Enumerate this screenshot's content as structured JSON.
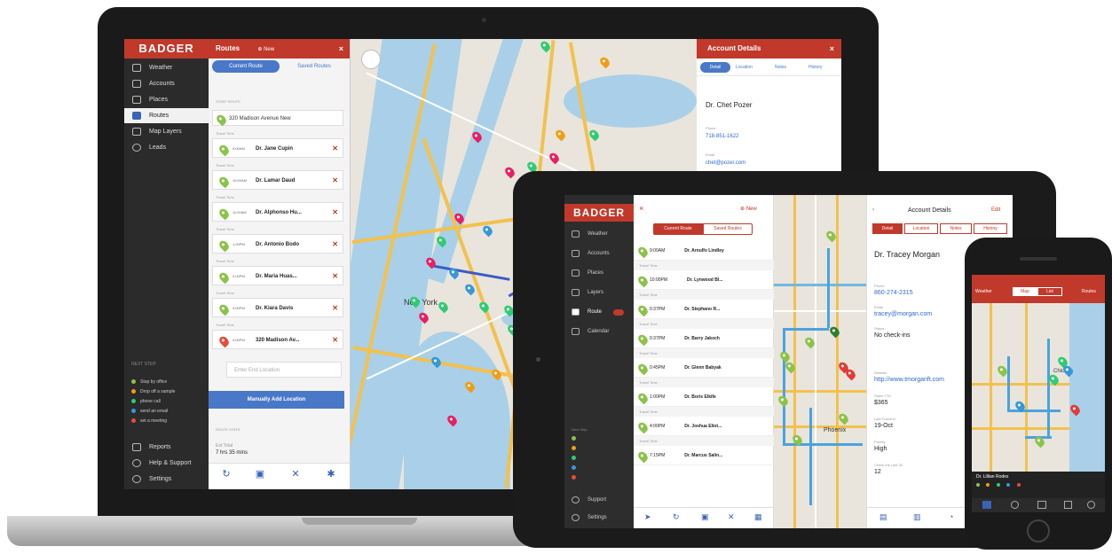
{
  "laptop": {
    "logo": "BADGER",
    "nav": [
      {
        "label": "Weather",
        "icon": "eye-icon"
      },
      {
        "label": "Accounts",
        "icon": "user-icon"
      },
      {
        "label": "Places",
        "icon": "building-icon"
      },
      {
        "label": "Routes",
        "icon": "map-icon",
        "active": true
      },
      {
        "label": "Map Layers",
        "icon": "layers-icon"
      },
      {
        "label": "Leads",
        "icon": "chat-icon"
      }
    ],
    "legend_title": "NEXT STEP",
    "legend": [
      {
        "label": "Stop by office",
        "color": "#8bc34a"
      },
      {
        "label": "Drop off a sample",
        "color": "#f39c12"
      },
      {
        "label": "phone call",
        "color": "#2ecc71"
      },
      {
        "label": "send an email",
        "color": "#3498db"
      },
      {
        "label": "set a meeting",
        "color": "#e74c3c"
      }
    ],
    "bottom_nav": [
      {
        "label": "Reports",
        "icon": "reports-icon"
      },
      {
        "label": "Help & Support",
        "icon": "help-icon"
      },
      {
        "label": "Settings",
        "icon": "gear-icon"
      }
    ],
    "routes_title": "Routes",
    "routes_new": "New",
    "tabs": {
      "current": "Current Route",
      "saved": "Saved Routes"
    },
    "start_label": "START ROUTE",
    "start_address": "320 Madison Avenue New",
    "stops": [
      {
        "time": "9:00AM",
        "name": "Dr. Jane Cupin"
      },
      {
        "time": "10:00AM",
        "name": "Dr. Lamar Daud"
      },
      {
        "time": "11:00AM",
        "name": "Dr. Alphonso Hu..."
      },
      {
        "time": "1:00PM",
        "name": "Dr. Antonio Bodo"
      },
      {
        "time": "2:00PM",
        "name": "Dr. Maria Huas..."
      },
      {
        "time": "3:00PM",
        "name": "Dr. Kiara Davis"
      },
      {
        "time": "4:00PM",
        "name": "320 Madison Av..."
      }
    ],
    "travel_label": "Travel Time",
    "end_placeholder": "Enter End Location",
    "manual_button": "Manually Add Location",
    "route_stats": "ROUTE STATS",
    "est_label": "Est Total",
    "est_value": "7 hrs 35 mins",
    "account_title": "Account Details",
    "account_tabs": [
      "Detail",
      "Location",
      "Notes",
      "History"
    ],
    "account_name": "Dr. Chet Pozer",
    "account_phone_label": "Phone",
    "account_phone": "718-851-1622",
    "account_email_label": "Email",
    "account_email": "chet@pozer.com"
  },
  "tablet": {
    "logo": "BADGER",
    "new_label": "New",
    "tabs": {
      "current": "Current Route",
      "saved": "Saved Routes"
    },
    "nav": [
      "Weather",
      "Accounts",
      "Places",
      "Layers",
      "Route",
      "Calendar"
    ],
    "bottom_nav": [
      "Support",
      "Settings"
    ],
    "legend_title": "Next Step",
    "stops": [
      {
        "time": "9:00AM",
        "name": "Dr. Arnulfo Lindley"
      },
      {
        "time": "10:00PM",
        "name": "Dr. Lynwood Bl..."
      },
      {
        "time": "0:37PM",
        "name": "Dr. Stephano R..."
      },
      {
        "time": "0:37PM",
        "name": "Dr. Barry Jakoch"
      },
      {
        "time": "0:45PM",
        "name": "Dr. Glenn Babyak"
      },
      {
        "time": "1:00PM",
        "name": "Dr. Boris Elkife"
      },
      {
        "time": "4:00PM",
        "name": "Dr. Joshua Eliot..."
      },
      {
        "time": "7:15PM",
        "name": "Dr. Marcus Salin..."
      }
    ],
    "travel_label": "Travel Time",
    "account_title": "Account Details",
    "account_edit": "Edit",
    "account_tabs": [
      "Detail",
      "Location",
      "Notes",
      "History"
    ],
    "account_name": "Dr. Tracey Morgan",
    "fields": [
      {
        "label": "Phone",
        "value": "860-274-2315",
        "link": true
      },
      {
        "label": "Email",
        "value": "tracey@morgan.com",
        "link": true
      },
      {
        "label": "Status",
        "value": "No check-ins",
        "link": false
      },
      {
        "label": "Website",
        "value": "http://www.tmorganft.com",
        "link": true
      },
      {
        "label": "Sales YTD",
        "value": "$365",
        "link": false
      },
      {
        "label": "Last Check-in",
        "value": "19-Oct",
        "link": false
      },
      {
        "label": "Priority",
        "value": "High",
        "link": false
      },
      {
        "label": "Check-ins Last 30",
        "value": "12",
        "link": false
      }
    ],
    "map_label": "Phoenix"
  },
  "phone": {
    "weather": "Weather",
    "segment": [
      "Map",
      "List"
    ],
    "routes": "Routes",
    "map_label": "Chicago",
    "info_name": "Dr. Lillian Rodes"
  }
}
